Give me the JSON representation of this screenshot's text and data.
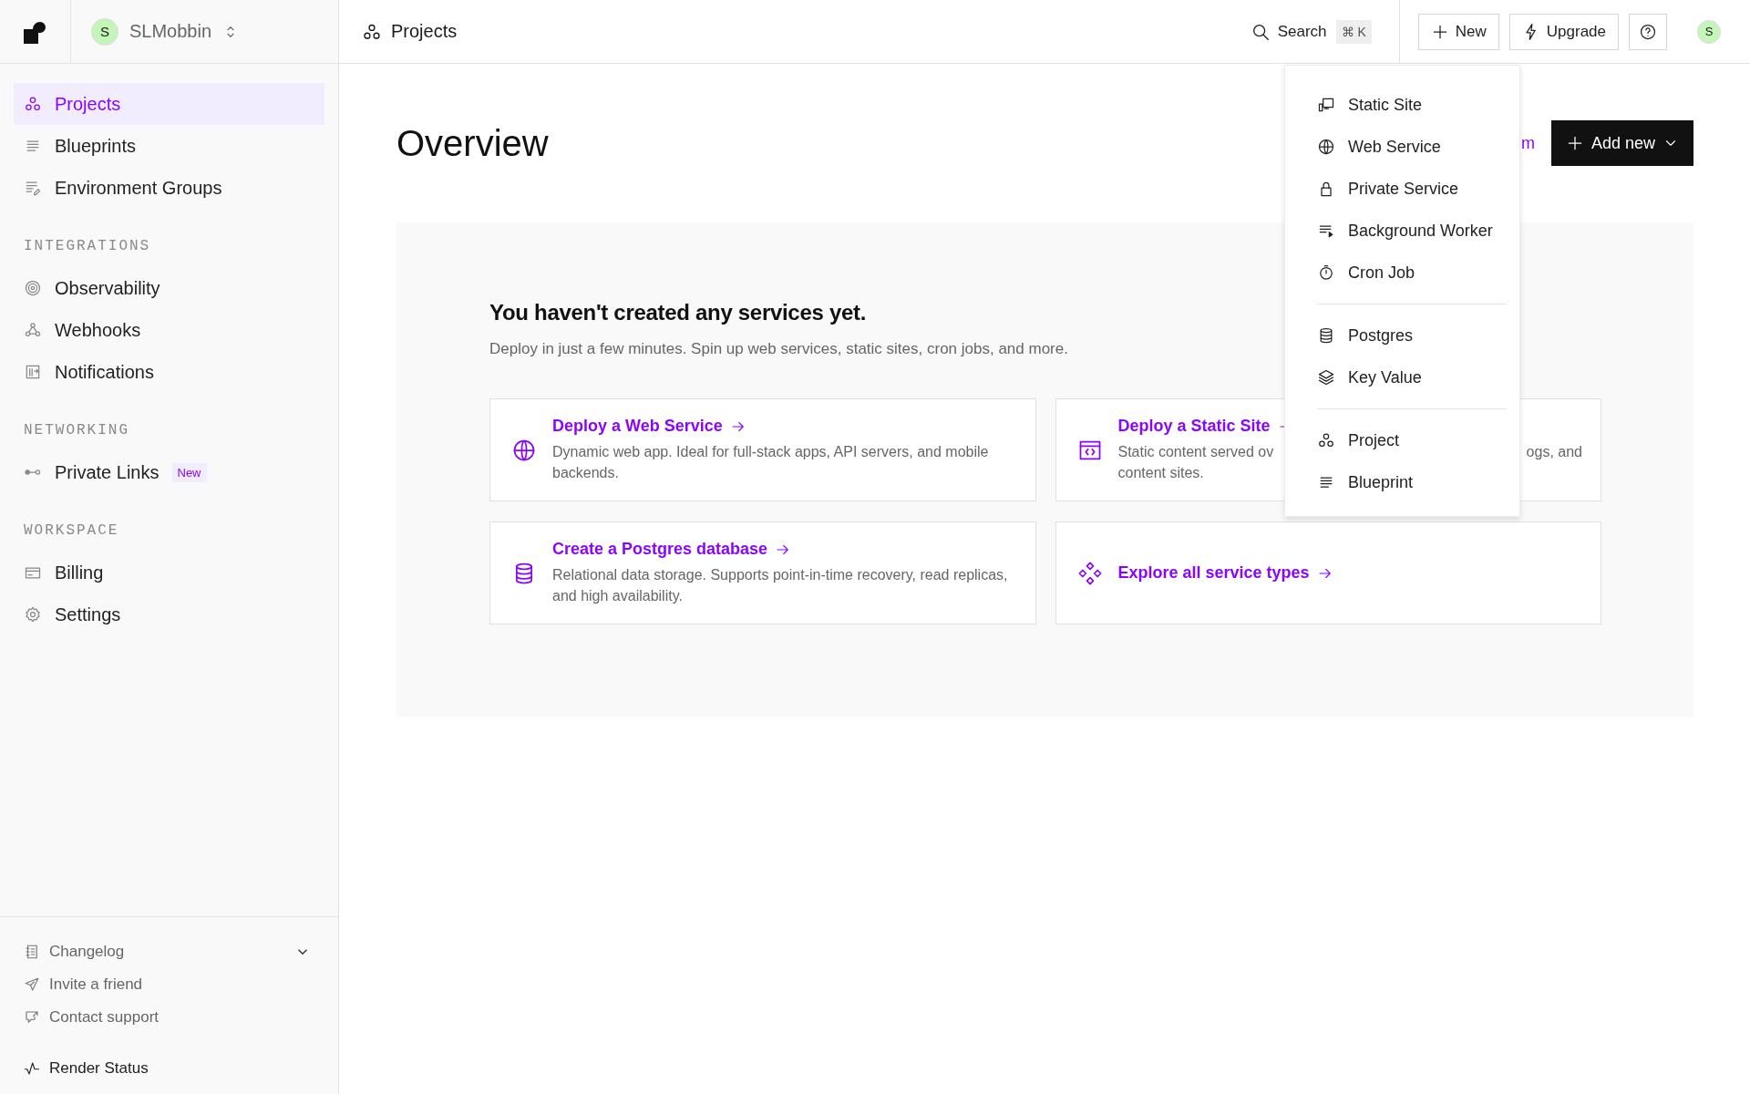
{
  "org": {
    "avatar": "S",
    "name": "SLMobbin"
  },
  "breadcrumb": {
    "label": "Projects"
  },
  "topbar": {
    "search": "Search",
    "shortcut": "⌘ K",
    "new_button": "New",
    "upgrade_button": "Upgrade",
    "avatar": "S"
  },
  "sidebar": {
    "sections": [
      {
        "items": [
          {
            "label": "Projects",
            "selected": true
          },
          {
            "label": "Blueprints",
            "selected": false
          },
          {
            "label": "Environment Groups",
            "selected": false
          }
        ]
      },
      {
        "title": "INTEGRATIONS",
        "items": [
          {
            "label": "Observability",
            "selected": false
          },
          {
            "label": "Webhooks",
            "selected": false
          },
          {
            "label": "Notifications",
            "selected": false
          }
        ]
      },
      {
        "title": "NETWORKING",
        "items": [
          {
            "label": "Private Links",
            "selected": false,
            "badge": "New"
          }
        ]
      },
      {
        "title": "WORKSPACE",
        "items": [
          {
            "label": "Billing",
            "selected": false
          },
          {
            "label": "Settings",
            "selected": false
          }
        ]
      }
    ],
    "footer": [
      {
        "label": "Changelog",
        "expanded": false
      },
      {
        "label": "Invite a friend"
      },
      {
        "label": "Contact support"
      }
    ],
    "status": "Render Status"
  },
  "main": {
    "title": "Overview",
    "link_fragment": "m",
    "add_button": "Add new",
    "empty": {
      "heading": "You haven't created any services yet.",
      "text": "Deploy in just a few minutes. Spin up web services, static sites, cron jobs, and more."
    },
    "cards": [
      {
        "kind": "full",
        "title": "Deploy a Web Service",
        "description": "Dynamic web app. Ideal for full-stack apps, API servers, and mobile backends."
      },
      {
        "kind": "occluded",
        "title": "Deploy a Static Site",
        "description_start": "Static content served ov",
        "description_end": "ogs, and",
        "description_line2": "content sites."
      },
      {
        "kind": "full",
        "title": "Create a Postgres database",
        "description": "Relational data storage. Supports point-in-time recovery, read replicas, and high availability."
      },
      {
        "kind": "link",
        "title": "Explore all service types"
      }
    ]
  },
  "dropdown": {
    "groups": [
      [
        "Static Site",
        "Web Service",
        "Private Service",
        "Background Worker",
        "Cron Job"
      ],
      [
        "Postgres",
        "Key Value"
      ],
      [
        "Project",
        "Blueprint"
      ]
    ]
  }
}
